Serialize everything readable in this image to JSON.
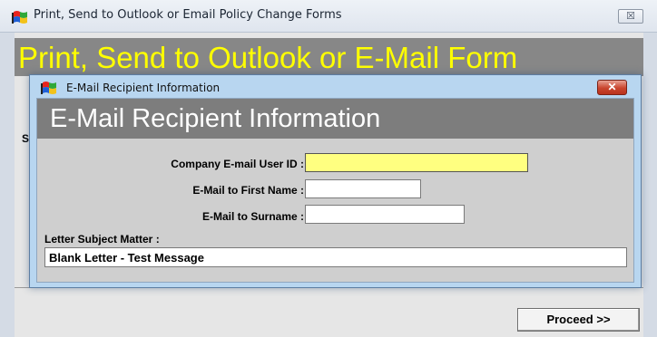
{
  "outer_window": {
    "title": "Print, Send to Outlook or Email Policy Change Forms",
    "close_label": "☒",
    "header_title": "Print, Send to Outlook or E-Mail Form",
    "side_letter": "S",
    "proceed_label": "Proceed >>"
  },
  "dialog": {
    "title": "E-Mail Recipient Information",
    "close_label": "✕",
    "header_title": "E-Mail Recipient Information",
    "fields": {
      "user_id": {
        "label": "Company E-mail User ID :",
        "value": ""
      },
      "first_name": {
        "label": "E-Mail to First Name  :",
        "value": ""
      },
      "surname": {
        "label": "E-Mail to Surname :",
        "value": ""
      }
    },
    "subject": {
      "label": "Letter Subject Matter :",
      "value": "Blank Letter - Test Message"
    }
  },
  "colors": {
    "outer_header_bg": "#878787",
    "outer_header_text": "#ffff00",
    "dialog_header_bg": "#7d7d7d",
    "dialog_frame": "#b8d6f0",
    "focused_input_bg": "#ffff80",
    "dialog_close_bg": "#c9452e"
  },
  "icons": {
    "app": "windows-flag-icon",
    "outer_close": "close-icon",
    "dialog_close": "close-icon"
  }
}
